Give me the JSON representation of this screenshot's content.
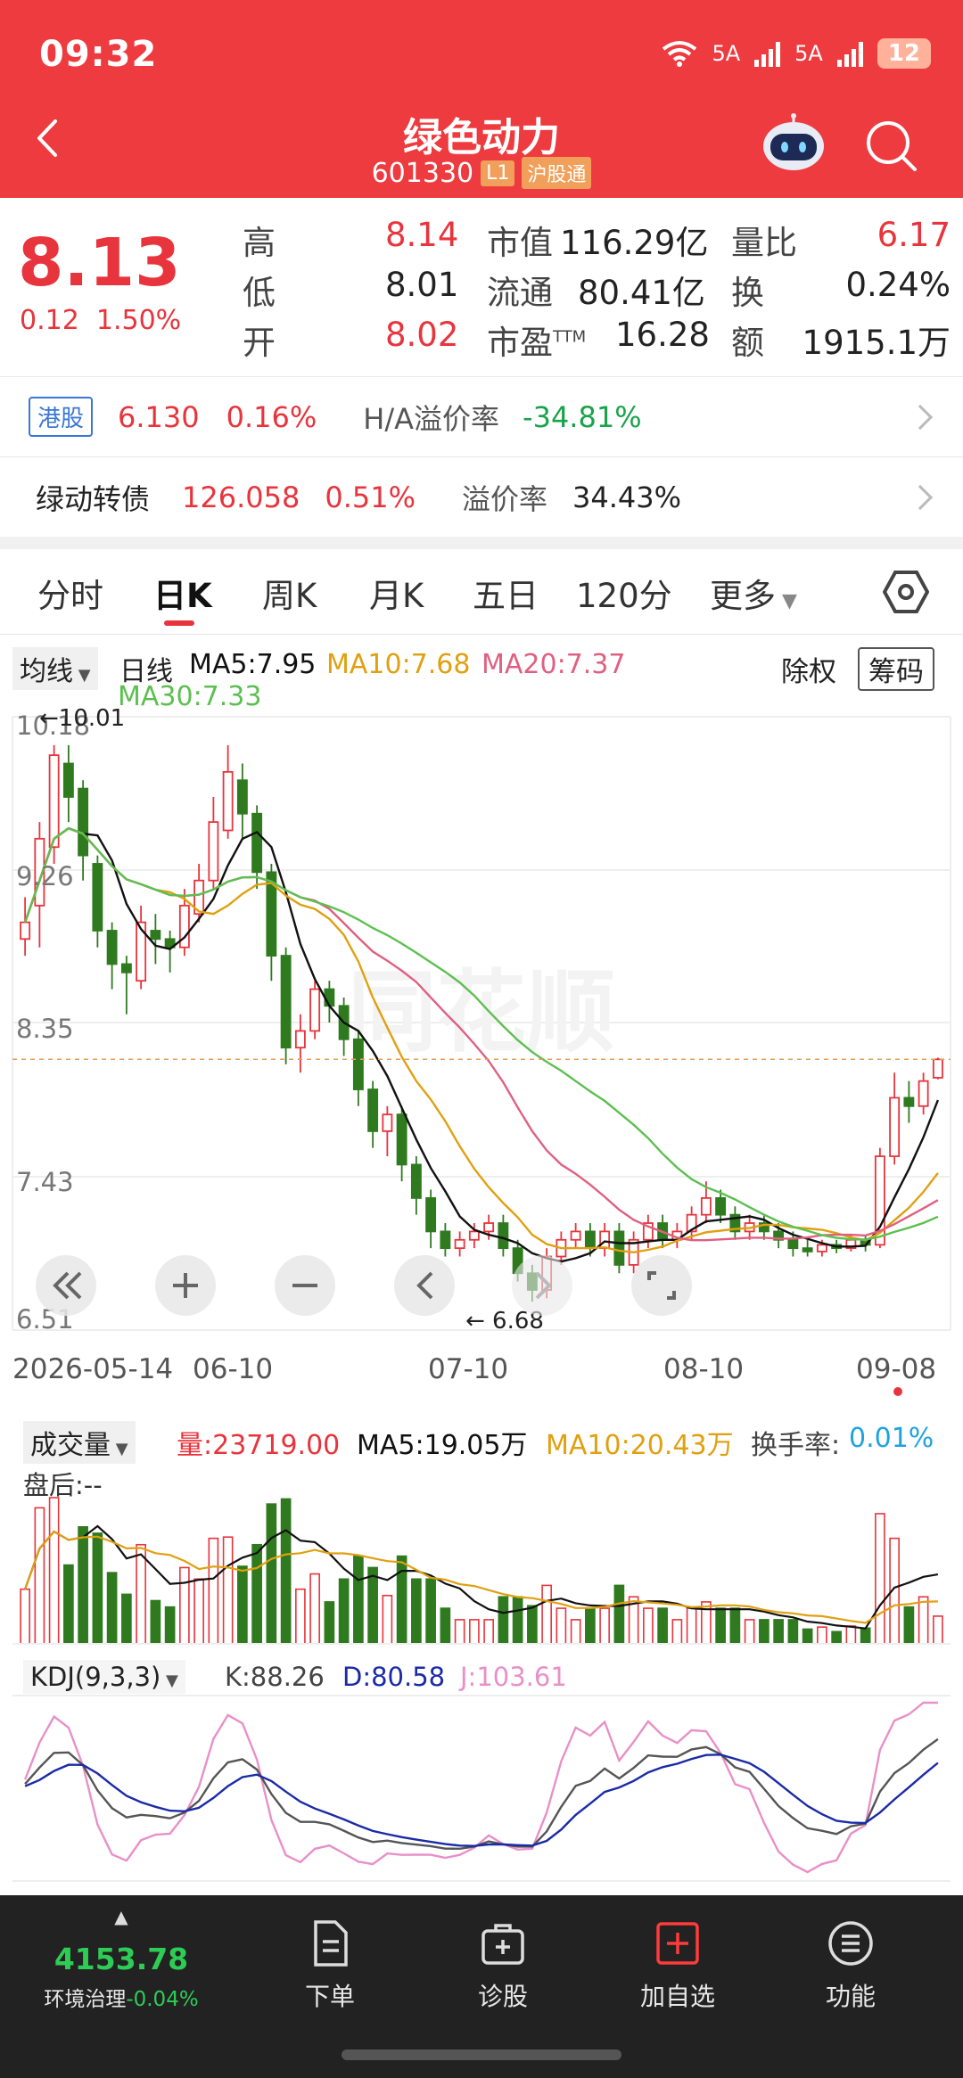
{
  "status_bar": {
    "time": "09:32",
    "network_1": "5A",
    "network_2": "5A",
    "battery": "12"
  },
  "header": {
    "title": "绿色动力",
    "code": "601330",
    "tag_l1": "L1",
    "tag_exchange": "沪股通"
  },
  "quote": {
    "price": "8.13",
    "change": "0.12",
    "change_pct": "1.50%",
    "rows": [
      {
        "l1": "高",
        "v1": "8.14",
        "l2": "市值",
        "v2": "116.29亿",
        "l3": "量比",
        "v3": "6.17"
      },
      {
        "l1": "低",
        "v1": "8.01",
        "l2": "流通",
        "v2": "80.41亿",
        "l3": "换",
        "v3": "0.24%"
      },
      {
        "l1": "开",
        "v1": "8.02",
        "l2": "市盈",
        "l2_sup": "TTM",
        "v2": "16.28",
        "l3": "额",
        "v3": "1915.1万"
      }
    ]
  },
  "hk_row": {
    "tag": "港股",
    "price": "6.130",
    "pct": "0.16%",
    "premium_label": "H/A溢价率",
    "premium": "-34.81%"
  },
  "bond_row": {
    "name": "绿动转债",
    "price": "126.058",
    "pct": "0.51%",
    "premium_label": "溢价率",
    "premium": "34.43%"
  },
  "tabs": [
    "分时",
    "日K",
    "周K",
    "月K",
    "五日",
    "120分",
    "更多"
  ],
  "active_tab": "日K",
  "ma_legend": {
    "dropdown": "均线",
    "period": "日线",
    "ma5": "MA5:7.95",
    "ma10": "MA10:7.68",
    "ma20": "MA20:7.37",
    "ma30": "MA30:7.33",
    "chuquan": "除权",
    "chouma": "筹码"
  },
  "kline": {
    "y_labels": [
      "10.18",
      "9.26",
      "8.35",
      "7.43",
      "6.51"
    ],
    "high_marker": "←10.01",
    "low_marker": "← 6.68",
    "watermark": "同花顺",
    "dates": [
      "2026-05-14",
      "06-10",
      "07-10",
      "08-10",
      "09-08"
    ]
  },
  "chart_data": {
    "type": "candlestick",
    "ylim": [
      6.51,
      10.18
    ],
    "candles": [
      [
        8.85,
        8.95,
        8.75,
        9.1
      ],
      [
        9.05,
        9.45,
        8.8,
        9.55
      ],
      [
        9.4,
        9.95,
        9.3,
        10.01
      ],
      [
        9.9,
        9.7,
        9.55,
        10.01
      ],
      [
        9.75,
        9.35,
        9.2,
        9.8
      ],
      [
        9.3,
        8.9,
        8.8,
        9.35
      ],
      [
        8.9,
        8.7,
        8.55,
        8.95
      ],
      [
        8.7,
        8.65,
        8.4,
        8.75
      ],
      [
        8.6,
        8.95,
        8.55,
        9.05
      ],
      [
        8.9,
        8.85,
        8.7,
        9.0
      ],
      [
        8.85,
        8.8,
        8.65,
        8.9
      ],
      [
        8.8,
        9.05,
        8.75,
        9.15
      ],
      [
        9.0,
        9.2,
        8.95,
        9.3
      ],
      [
        9.2,
        9.55,
        9.15,
        9.7
      ],
      [
        9.5,
        9.85,
        9.45,
        10.01
      ],
      [
        9.8,
        9.6,
        9.45,
        9.9
      ],
      [
        9.6,
        9.25,
        9.15,
        9.65
      ],
      [
        9.25,
        8.75,
        8.6,
        9.3
      ],
      [
        8.75,
        8.2,
        8.1,
        8.8
      ],
      [
        8.2,
        8.3,
        8.05,
        8.4
      ],
      [
        8.3,
        8.55,
        8.25,
        8.6
      ],
      [
        8.55,
        8.45,
        8.35,
        8.6
      ],
      [
        8.45,
        8.25,
        8.15,
        8.5
      ],
      [
        8.25,
        7.95,
        7.85,
        8.3
      ],
      [
        7.95,
        7.7,
        7.6,
        8.0
      ],
      [
        7.7,
        7.8,
        7.55,
        7.85
      ],
      [
        7.8,
        7.5,
        7.4,
        7.85
      ],
      [
        7.5,
        7.3,
        7.2,
        7.55
      ],
      [
        7.3,
        7.1,
        7.0,
        7.35
      ],
      [
        7.1,
        7.0,
        6.95,
        7.15
      ],
      [
        7.0,
        7.05,
        6.95,
        7.1
      ],
      [
        7.05,
        7.1,
        7.0,
        7.15
      ],
      [
        7.1,
        7.15,
        7.05,
        7.2
      ],
      [
        7.15,
        7.0,
        6.95,
        7.2
      ],
      [
        7.0,
        6.85,
        6.8,
        7.05
      ],
      [
        6.85,
        6.75,
        6.68,
        6.9
      ],
      [
        6.75,
        6.95,
        6.7,
        7.0
      ],
      [
        6.95,
        7.05,
        6.9,
        7.1
      ],
      [
        7.05,
        7.1,
        7.0,
        7.15
      ],
      [
        7.1,
        7.0,
        6.95,
        7.15
      ],
      [
        7.0,
        7.1,
        6.95,
        7.15
      ],
      [
        7.1,
        6.9,
        6.85,
        7.15
      ],
      [
        6.9,
        7.05,
        6.85,
        7.1
      ],
      [
        7.05,
        7.15,
        7.0,
        7.2
      ],
      [
        7.15,
        7.05,
        7.0,
        7.2
      ],
      [
        7.05,
        7.1,
        7.0,
        7.15
      ],
      [
        7.1,
        7.2,
        7.05,
        7.25
      ],
      [
        7.2,
        7.3,
        7.15,
        7.4
      ],
      [
        7.3,
        7.2,
        7.15,
        7.35
      ],
      [
        7.2,
        7.1,
        7.05,
        7.25
      ],
      [
        7.1,
        7.15,
        7.05,
        7.2
      ],
      [
        7.15,
        7.1,
        7.05,
        7.2
      ],
      [
        7.1,
        7.05,
        7.0,
        7.15
      ],
      [
        7.05,
        7.0,
        6.95,
        7.1
      ],
      [
        7.0,
        6.98,
        6.95,
        7.05
      ],
      [
        6.98,
        7.02,
        6.95,
        7.05
      ],
      [
        7.02,
        7.0,
        6.97,
        7.05
      ],
      [
        7.0,
        7.05,
        6.98,
        7.08
      ],
      [
        7.05,
        7.02,
        6.98,
        7.08
      ],
      [
        7.02,
        7.55,
        7.0,
        7.6
      ],
      [
        7.55,
        7.9,
        7.5,
        8.05
      ],
      [
        7.9,
        7.85,
        7.75,
        8.0
      ],
      [
        7.85,
        8.0,
        7.8,
        8.05
      ],
      [
        8.02,
        8.13,
        8.01,
        8.14
      ]
    ],
    "ma5_value": 7.95,
    "ma10_value": 7.68,
    "ma20_value": 7.37,
    "ma30_value": 7.33
  },
  "volume": {
    "dropdown": "成交量",
    "vol": "量:23719.00",
    "ma5": "MA5:19.05万",
    "ma10": "MA10:20.43万",
    "turnover_label": "换手率:",
    "turnover": "0.01%",
    "after_hours": "盘后:--"
  },
  "kdj": {
    "dropdown": "KDJ(9,3,3)",
    "k": "K:88.26",
    "d": "D:80.58",
    "j": "J:103.61"
  },
  "bottom_nav": {
    "index_value": "4153.78",
    "index_name": "环境治理",
    "index_pct": "-0.04%",
    "items": [
      "下单",
      "诊股",
      "加自选",
      "功能"
    ]
  },
  "colors": {
    "up": "#e8343c",
    "down": "#2f7a1f",
    "header_bg": "#ee3b3f",
    "ma5": "#111111",
    "ma10": "#e0a010",
    "ma20": "#e06080",
    "ma30": "#5cc050"
  }
}
